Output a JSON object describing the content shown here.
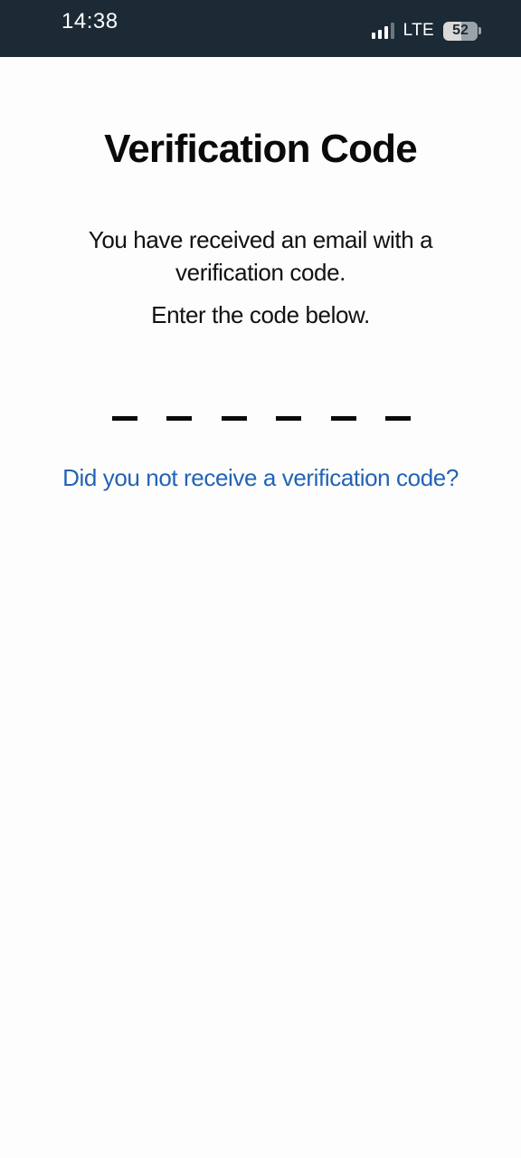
{
  "status_bar": {
    "time": "14:38",
    "network": "LTE",
    "battery": "52",
    "signal_bars": 4,
    "signal_bars_active": 3,
    "battery_level": 0.52,
    "background_color": "#1b2a35"
  },
  "screen": {
    "title": "Verification Code",
    "message": "You have received an email with a verification code.",
    "instruction": "Enter the code below.",
    "code_length": 6,
    "code_digits": [
      "",
      "",
      "",
      "",
      "",
      ""
    ],
    "resend_link": "Did you not receive a verification code?",
    "link_color": "#2363b5"
  }
}
